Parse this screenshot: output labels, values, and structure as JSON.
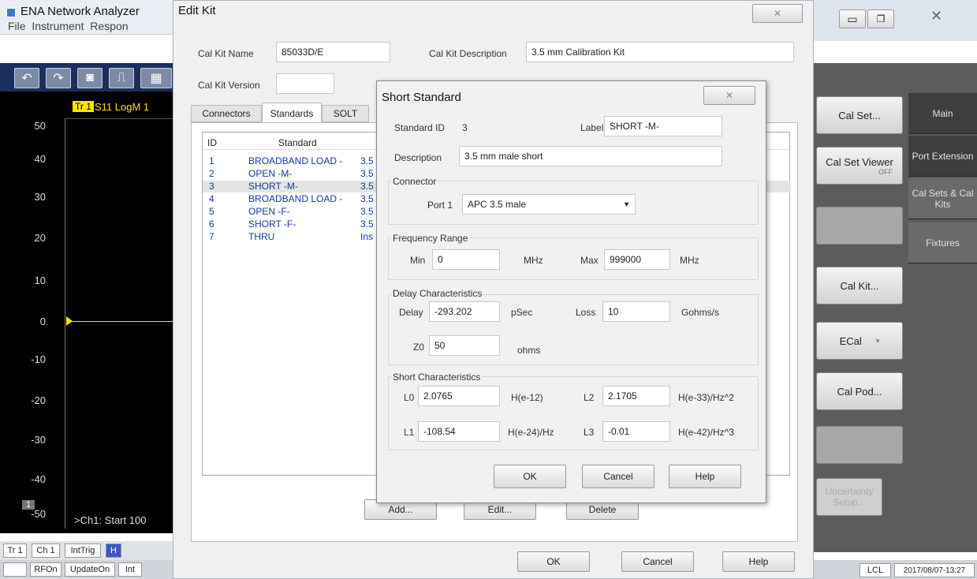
{
  "app": {
    "title": "ENA Network Analyzer",
    "menu": [
      "File",
      "Instrument",
      "Respon"
    ],
    "trace_label": "Tr 1",
    "trace_measure": "S11 LogM 1",
    "y_ticks": [
      "50",
      "40",
      "30",
      "20",
      "10",
      "0",
      "-10",
      "-20",
      "-30",
      "-40",
      "-50"
    ],
    "channel_badge": "1",
    "start_text": ">Ch1: Start  100",
    "status_row1": [
      "Tr 1",
      "Ch 1",
      "IntTrig",
      "H"
    ],
    "status_row2": [
      "",
      "RFOn",
      "UpdateOn",
      "Int"
    ],
    "status_right": [
      "LCL",
      "2017/08/07-13:27"
    ],
    "window_close": "X"
  },
  "right_panel": {
    "buttons": [
      "Cal Set...",
      "Cal Set Viewer",
      "",
      "Cal Kit...",
      "ECal",
      "Cal Pod...",
      "",
      "Uncertainty Setup..."
    ],
    "viewer_toggle": "OFF",
    "tabs": [
      "Main",
      "Port Extension",
      "Cal Sets & Cal Kits",
      "Fixtures"
    ]
  },
  "edit_kit": {
    "title": "Edit Kit",
    "name_label": "Cal Kit Name",
    "name_value": "85033D/E",
    "desc_label": "Cal Kit Description",
    "desc_value": "3.5 mm Calibration Kit",
    "version_label": "Cal Kit Version",
    "version_value": "",
    "tabs": [
      "Connectors",
      "Standards",
      "SOLT"
    ],
    "columns": [
      "ID",
      "Standard"
    ],
    "rows": [
      {
        "id": "1",
        "name": "BROADBAND LOAD -",
        "desc": "3.5"
      },
      {
        "id": "2",
        "name": "OPEN -M-",
        "desc": "3.5"
      },
      {
        "id": "3",
        "name": "SHORT -M-",
        "desc": "3.5"
      },
      {
        "id": "4",
        "name": "BROADBAND LOAD -",
        "desc": "3.5"
      },
      {
        "id": "5",
        "name": "OPEN -F-",
        "desc": "3.5"
      },
      {
        "id": "6",
        "name": "SHORT -F-",
        "desc": "3.5"
      },
      {
        "id": "7",
        "name": "THRU",
        "desc": "Ins"
      }
    ],
    "add_label": "Add...",
    "edit_label": "Edit...",
    "delete_label": "Delete",
    "ok_label": "OK",
    "cancel_label": "Cancel",
    "help_label": "Help"
  },
  "short_std": {
    "title": "Short Standard",
    "std_id_label": "Standard ID",
    "std_id_value": "3",
    "label_label": "Label",
    "label_value": "SHORT -M-",
    "desc_label": "Description",
    "desc_value": "3.5 mm male short",
    "connector_title": "Connector",
    "port_label": "Port 1",
    "port_value": "APC 3.5 male",
    "freq_title": "Frequency Range",
    "min_label": "Min",
    "min_value": "0",
    "min_unit": "MHz",
    "max_label": "Max",
    "max_value": "999000",
    "max_unit": "MHz",
    "delay_title": "Delay Characteristics",
    "delay_label": "Delay",
    "delay_value": "-293.202",
    "delay_unit": "pSec",
    "loss_label": "Loss",
    "loss_value": "10",
    "loss_unit": "Gohms/s",
    "z0_label": "Z0",
    "z0_value": "50",
    "z0_unit": "ohms",
    "short_title": "Short Characteristics",
    "l0_label": "L0",
    "l0_value": "2.0765",
    "l0_unit": "H(e-12)",
    "l1_label": "L1",
    "l1_value": "-108.54",
    "l1_unit": "H(e-24)/Hz",
    "l2_label": "L2",
    "l2_value": "2.1705",
    "l2_unit": "H(e-33)/Hz^2",
    "l3_label": "L3",
    "l3_value": "-0.01",
    "l3_unit": "H(e-42)/Hz^3",
    "ok_label": "OK",
    "cancel_label": "Cancel",
    "help_label": "Help"
  }
}
